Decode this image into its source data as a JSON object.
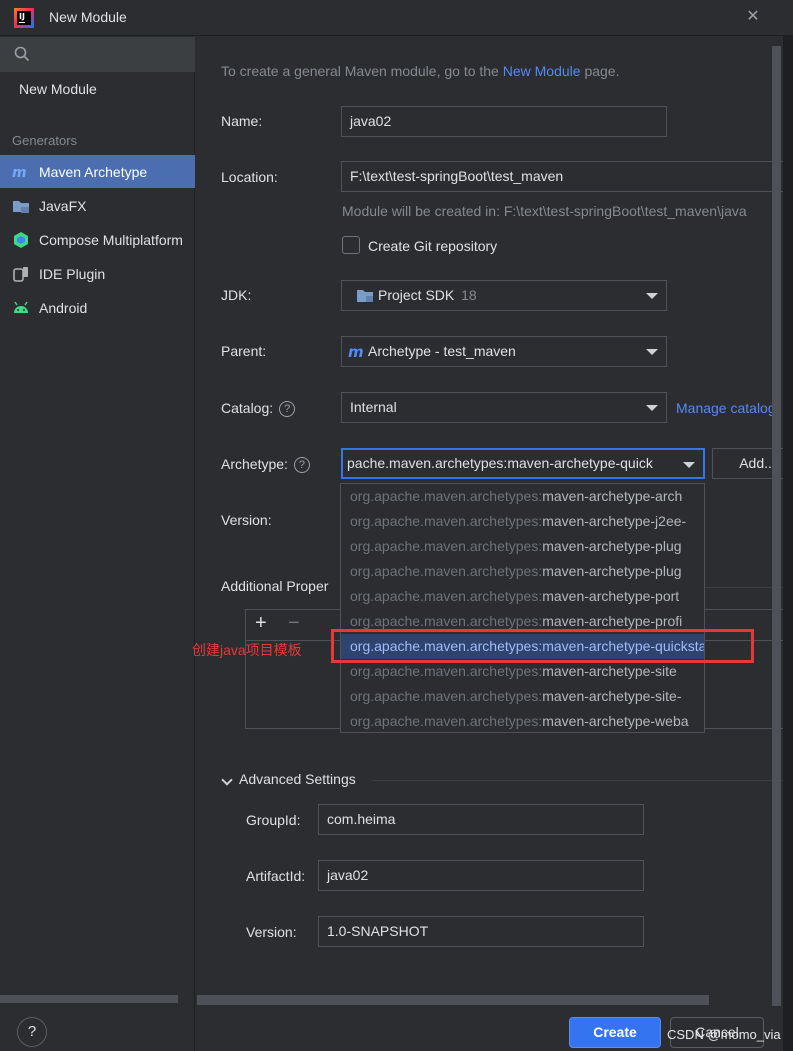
{
  "window": {
    "title": "New Module",
    "close_glyph": "✕"
  },
  "sidebar": {
    "search_icon": "search-icon",
    "new_module": "New Module",
    "generators_label": "Generators",
    "items": [
      {
        "label": "Maven Archetype",
        "icon": "maven-icon",
        "selected": true
      },
      {
        "label": "JavaFX",
        "icon": "folder-icon",
        "selected": false
      },
      {
        "label": "Compose Multiplatform",
        "icon": "compose-icon",
        "selected": false
      },
      {
        "label": "IDE Plugin",
        "icon": "plugin-icon",
        "selected": false
      },
      {
        "label": "Android",
        "icon": "android-icon",
        "selected": false
      }
    ],
    "help_glyph": "?"
  },
  "form": {
    "info_prefix": "To create a general Maven module, go to the ",
    "info_link": "New Module",
    "info_suffix": " page.",
    "name_label": "Name:",
    "name_value": "java02",
    "location_label": "Location:",
    "location_value": "F:\\text\\test-springBoot\\test_maven",
    "location_hint": "Module will be created in: F:\\text\\test-springBoot\\test_maven\\java",
    "git_label": "Create Git repository",
    "jdk_label": "JDK:",
    "jdk_value": "Project SDK",
    "jdk_version": "18",
    "parent_label": "Parent:",
    "parent_value": "Archetype - test_maven",
    "catalog_label": "Catalog:",
    "catalog_value": "Internal",
    "manage_catalogs": "Manage catalog",
    "archetype_label": "Archetype:",
    "archetype_value": "pache.maven.archetypes:maven-archetype-quick",
    "add_button": "Add...",
    "version_label": "Version:",
    "additional_label": "Additional Proper",
    "add_prop": "+",
    "remove_prop": "−",
    "annotation": "创建java项目模板"
  },
  "archetype_dropdown": [
    {
      "prefix": "org.apache.maven.archetypes:",
      "name": "maven-archetype-arch",
      "selected": false
    },
    {
      "prefix": "org.apache.maven.archetypes:",
      "name": "maven-archetype-j2ee-",
      "selected": false
    },
    {
      "prefix": "org.apache.maven.archetypes:",
      "name": "maven-archetype-plug",
      "selected": false
    },
    {
      "prefix": "org.apache.maven.archetypes:",
      "name": "maven-archetype-plug",
      "selected": false
    },
    {
      "prefix": "org.apache.maven.archetypes:",
      "name": "maven-archetype-port",
      "selected": false
    },
    {
      "prefix": "org.apache.maven.archetypes:",
      "name": "maven-archetype-profi",
      "selected": false
    },
    {
      "prefix": "org.apache.maven.archetypes:",
      "name": "maven-archetype-quickstart",
      "selected": true
    },
    {
      "prefix": "org.apache.maven.archetypes:",
      "name": "maven-archetype-site",
      "selected": false
    },
    {
      "prefix": "org.apache.maven.archetypes:",
      "name": "maven-archetype-site-",
      "selected": false
    },
    {
      "prefix": "org.apache.maven.archetypes:",
      "name": "maven-archetype-weba",
      "selected": false
    }
  ],
  "advanced": {
    "title": "Advanced Settings",
    "groupid_label": "GroupId:",
    "groupid_value": "com.heima",
    "artifactid_label": "ArtifactId:",
    "artifactid_value": "java02",
    "version_label": "Version:",
    "version_value": "1.0-SNAPSHOT"
  },
  "footer": {
    "create": "Create",
    "cancel": "Cancel",
    "watermark": "CSDN @momo_via"
  },
  "colors": {
    "accent": "#3574f0",
    "selection": "#4a6eaf",
    "annotation": "#e5383b",
    "link": "#548af7"
  }
}
